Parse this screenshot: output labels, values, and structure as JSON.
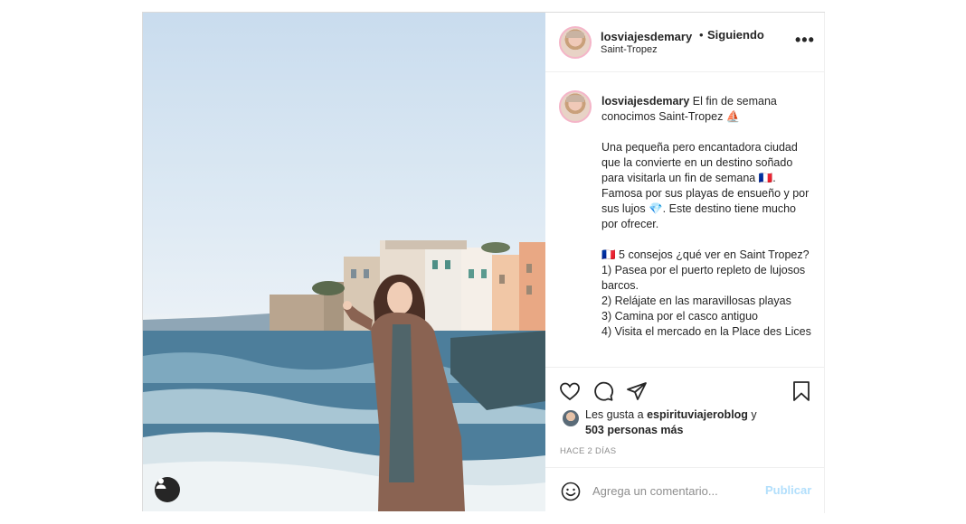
{
  "post": {
    "author": {
      "username": "losviajesdemary",
      "follow_separator": "•",
      "follow_status": "Siguiendo",
      "location": "Saint-Tropez"
    },
    "more_options_glyph": "•••",
    "caption": {
      "username": "losviajesdemary",
      "line1": " El fin de semana conocimos Saint-Tropez ⛵",
      "para2": "Una pequeña pero encantadora ciudad que la convierte en un destino soñado para visitarla un fin de semana 🇲🇫. Famosa por sus playas de ensueño y por sus lujos 💎. Este destino tiene mucho por ofrecer.",
      "para3_title": "🇲🇫 5 consejos ¿qué ver en Saint Tropez?",
      "tips": [
        "1) Pasea por el puerto repleto de lujosos barcos.",
        "2) Relájate en las maravillosas playas",
        "3) Camina por el casco antiguo",
        "4) Visita el mercado en la Place des Lices"
      ]
    },
    "likes": {
      "prefix": "Les gusta a ",
      "first_user": "espirituviajeroblog",
      "connector": " y",
      "others": "503 personas más"
    },
    "timestamp": "HACE 2 DÍAS",
    "comment": {
      "placeholder": "Agrega un comentario...",
      "value": "",
      "publish_label": "Publicar"
    },
    "icons": {
      "like": "heart-icon",
      "comment": "comment-icon",
      "share": "share-icon",
      "save": "bookmark-icon",
      "emoji": "emoji-icon",
      "tagged_user": "user-tag-icon"
    }
  }
}
